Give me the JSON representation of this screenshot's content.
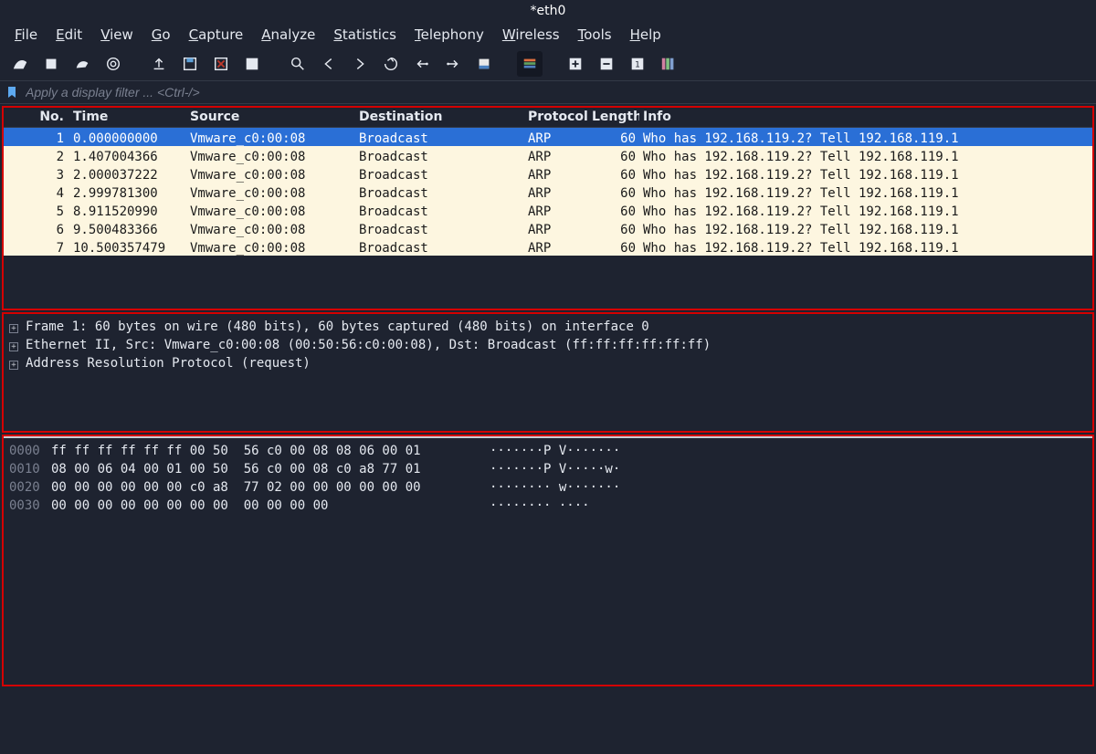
{
  "window": {
    "title": "*eth0"
  },
  "menu": {
    "items": [
      {
        "label": "File",
        "ul": "F"
      },
      {
        "label": "Edit",
        "ul": "E"
      },
      {
        "label": "View",
        "ul": "V"
      },
      {
        "label": "Go",
        "ul": "G"
      },
      {
        "label": "Capture",
        "ul": "C"
      },
      {
        "label": "Analyze",
        "ul": "A"
      },
      {
        "label": "Statistics",
        "ul": "S"
      },
      {
        "label": "Telephony",
        "ul": "T"
      },
      {
        "label": "Wireless",
        "ul": "W"
      },
      {
        "label": "Tools",
        "ul": "T"
      },
      {
        "label": "Help",
        "ul": "H"
      }
    ]
  },
  "filter": {
    "placeholder": "Apply a display filter ... <Ctrl-/>",
    "value": ""
  },
  "columns": {
    "no": "No.",
    "time": "Time",
    "src": "Source",
    "dst": "Destination",
    "proto": "Protocol",
    "len": "Length",
    "info": "Info"
  },
  "packets": [
    {
      "no": 1,
      "time": "0.000000000",
      "src": "Vmware_c0:00:08",
      "dst": "Broadcast",
      "proto": "ARP",
      "len": 60,
      "info": "Who has 192.168.119.2? Tell 192.168.119.1",
      "selected": true
    },
    {
      "no": 2,
      "time": "1.407004366",
      "src": "Vmware_c0:00:08",
      "dst": "Broadcast",
      "proto": "ARP",
      "len": 60,
      "info": "Who has 192.168.119.2? Tell 192.168.119.1"
    },
    {
      "no": 3,
      "time": "2.000037222",
      "src": "Vmware_c0:00:08",
      "dst": "Broadcast",
      "proto": "ARP",
      "len": 60,
      "info": "Who has 192.168.119.2? Tell 192.168.119.1"
    },
    {
      "no": 4,
      "time": "2.999781300",
      "src": "Vmware_c0:00:08",
      "dst": "Broadcast",
      "proto": "ARP",
      "len": 60,
      "info": "Who has 192.168.119.2? Tell 192.168.119.1"
    },
    {
      "no": 5,
      "time": "8.911520990",
      "src": "Vmware_c0:00:08",
      "dst": "Broadcast",
      "proto": "ARP",
      "len": 60,
      "info": "Who has 192.168.119.2? Tell 192.168.119.1"
    },
    {
      "no": 6,
      "time": "9.500483366",
      "src": "Vmware_c0:00:08",
      "dst": "Broadcast",
      "proto": "ARP",
      "len": 60,
      "info": "Who has 192.168.119.2? Tell 192.168.119.1"
    },
    {
      "no": 7,
      "time": "10.500357479",
      "src": "Vmware_c0:00:08",
      "dst": "Broadcast",
      "proto": "ARP",
      "len": 60,
      "info": "Who has 192.168.119.2? Tell 192.168.119.1"
    }
  ],
  "details": {
    "lines": [
      "Frame 1: 60 bytes on wire (480 bits), 60 bytes captured (480 bits) on interface 0",
      "Ethernet II, Src: Vmware_c0:00:08 (00:50:56:c0:00:08), Dst: Broadcast (ff:ff:ff:ff:ff:ff)",
      "Address Resolution Protocol (request)"
    ]
  },
  "hex": {
    "rows": [
      {
        "offset": "0000",
        "bytes": "ff ff ff ff ff ff 00 50  56 c0 00 08 08 06 00 01",
        "ascii": "·······P V·······"
      },
      {
        "offset": "0010",
        "bytes": "08 00 06 04 00 01 00 50  56 c0 00 08 c0 a8 77 01",
        "ascii": "·······P V·····w·"
      },
      {
        "offset": "0020",
        "bytes": "00 00 00 00 00 00 c0 a8  77 02 00 00 00 00 00 00",
        "ascii": "········ w·······"
      },
      {
        "offset": "0030",
        "bytes": "00 00 00 00 00 00 00 00  00 00 00 00",
        "ascii": "········ ····"
      }
    ]
  }
}
